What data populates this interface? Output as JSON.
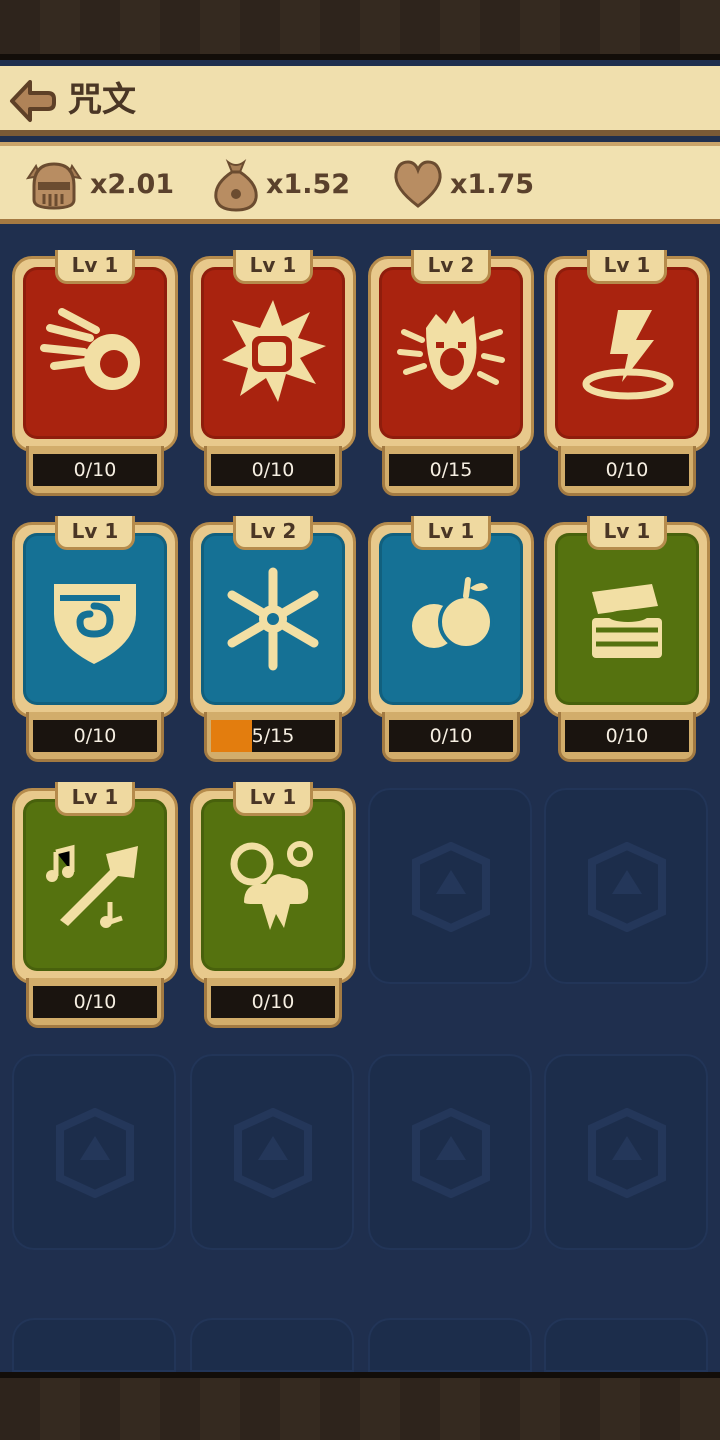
{
  "header": {
    "title": "咒文"
  },
  "stats": [
    {
      "icon": "knight-helmet-icon",
      "value": "x2.01"
    },
    {
      "icon": "money-bag-icon",
      "value": "x1.52"
    },
    {
      "icon": "heart-icon",
      "value": "x1.75"
    }
  ],
  "cards": [
    {
      "level": "Lv 1",
      "count": "0/10",
      "progress": 0,
      "color": "red",
      "icon": "fireball-icon"
    },
    {
      "level": "Lv 1",
      "count": "0/10",
      "progress": 0,
      "color": "red",
      "icon": "fist-burst-icon"
    },
    {
      "level": "Lv 2",
      "count": "0/15",
      "progress": 0,
      "color": "red",
      "icon": "battle-cry-icon"
    },
    {
      "level": "Lv 1",
      "count": "0/10",
      "progress": 0,
      "color": "red",
      "icon": "lightning-strike-icon"
    },
    {
      "level": "Lv 1",
      "count": "0/10",
      "progress": 0,
      "color": "blue",
      "icon": "whirlwind-shield-icon"
    },
    {
      "level": "Lv 2",
      "count": "5/15",
      "progress": 0.333,
      "color": "blue",
      "icon": "snowflake-icon"
    },
    {
      "level": "Lv 1",
      "count": "0/10",
      "progress": 0,
      "color": "blue",
      "icon": "apples-icon"
    },
    {
      "level": "Lv 1",
      "count": "0/10",
      "progress": 0,
      "color": "green",
      "icon": "treasure-chest-icon"
    },
    {
      "level": "Lv 1",
      "count": "0/10",
      "progress": 0,
      "color": "green",
      "icon": "horn-music-icon"
    },
    {
      "level": "Lv 1",
      "count": "0/10",
      "progress": 0,
      "color": "green",
      "icon": "weather-icon"
    }
  ],
  "colors": {
    "red": "#a9230f",
    "blue": "#157195",
    "green": "#55720f",
    "progress": "#e37d0e"
  }
}
